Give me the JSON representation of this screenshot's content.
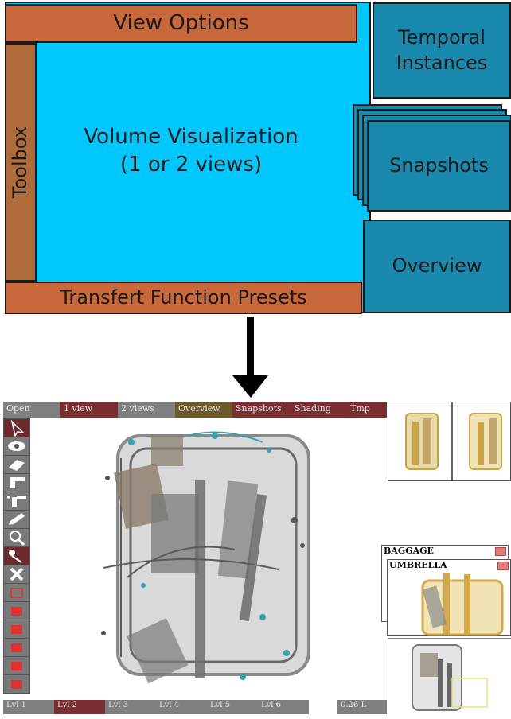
{
  "diagram": {
    "view_options": "View Options",
    "toolbox": "Toolbox",
    "volume_line1": "Volume Visualization",
    "volume_line2": "(1 or 2 views)",
    "temporal_line1": "Temporal",
    "temporal_line2": "Instances",
    "snapshots": "Snapshots",
    "overview": "Overview",
    "tf_presets": "Transfert Function Presets"
  },
  "screenshot": {
    "menu": {
      "open": "Open",
      "one_view": "1 view",
      "two_views": "2 views",
      "overview": "Overview",
      "snapshots": "Snapshots",
      "shading": "Shading",
      "tmp": "Tmp"
    },
    "levels": [
      "Lvl 1",
      "Lvl 2",
      "Lvl 3",
      "Lvl 4",
      "Lvl 5",
      "Lvl 6"
    ],
    "readout": "0.26 L",
    "snapshot_labels": {
      "baggage": "BAGGAGE",
      "umbrella": "UMBRELLA"
    }
  }
}
